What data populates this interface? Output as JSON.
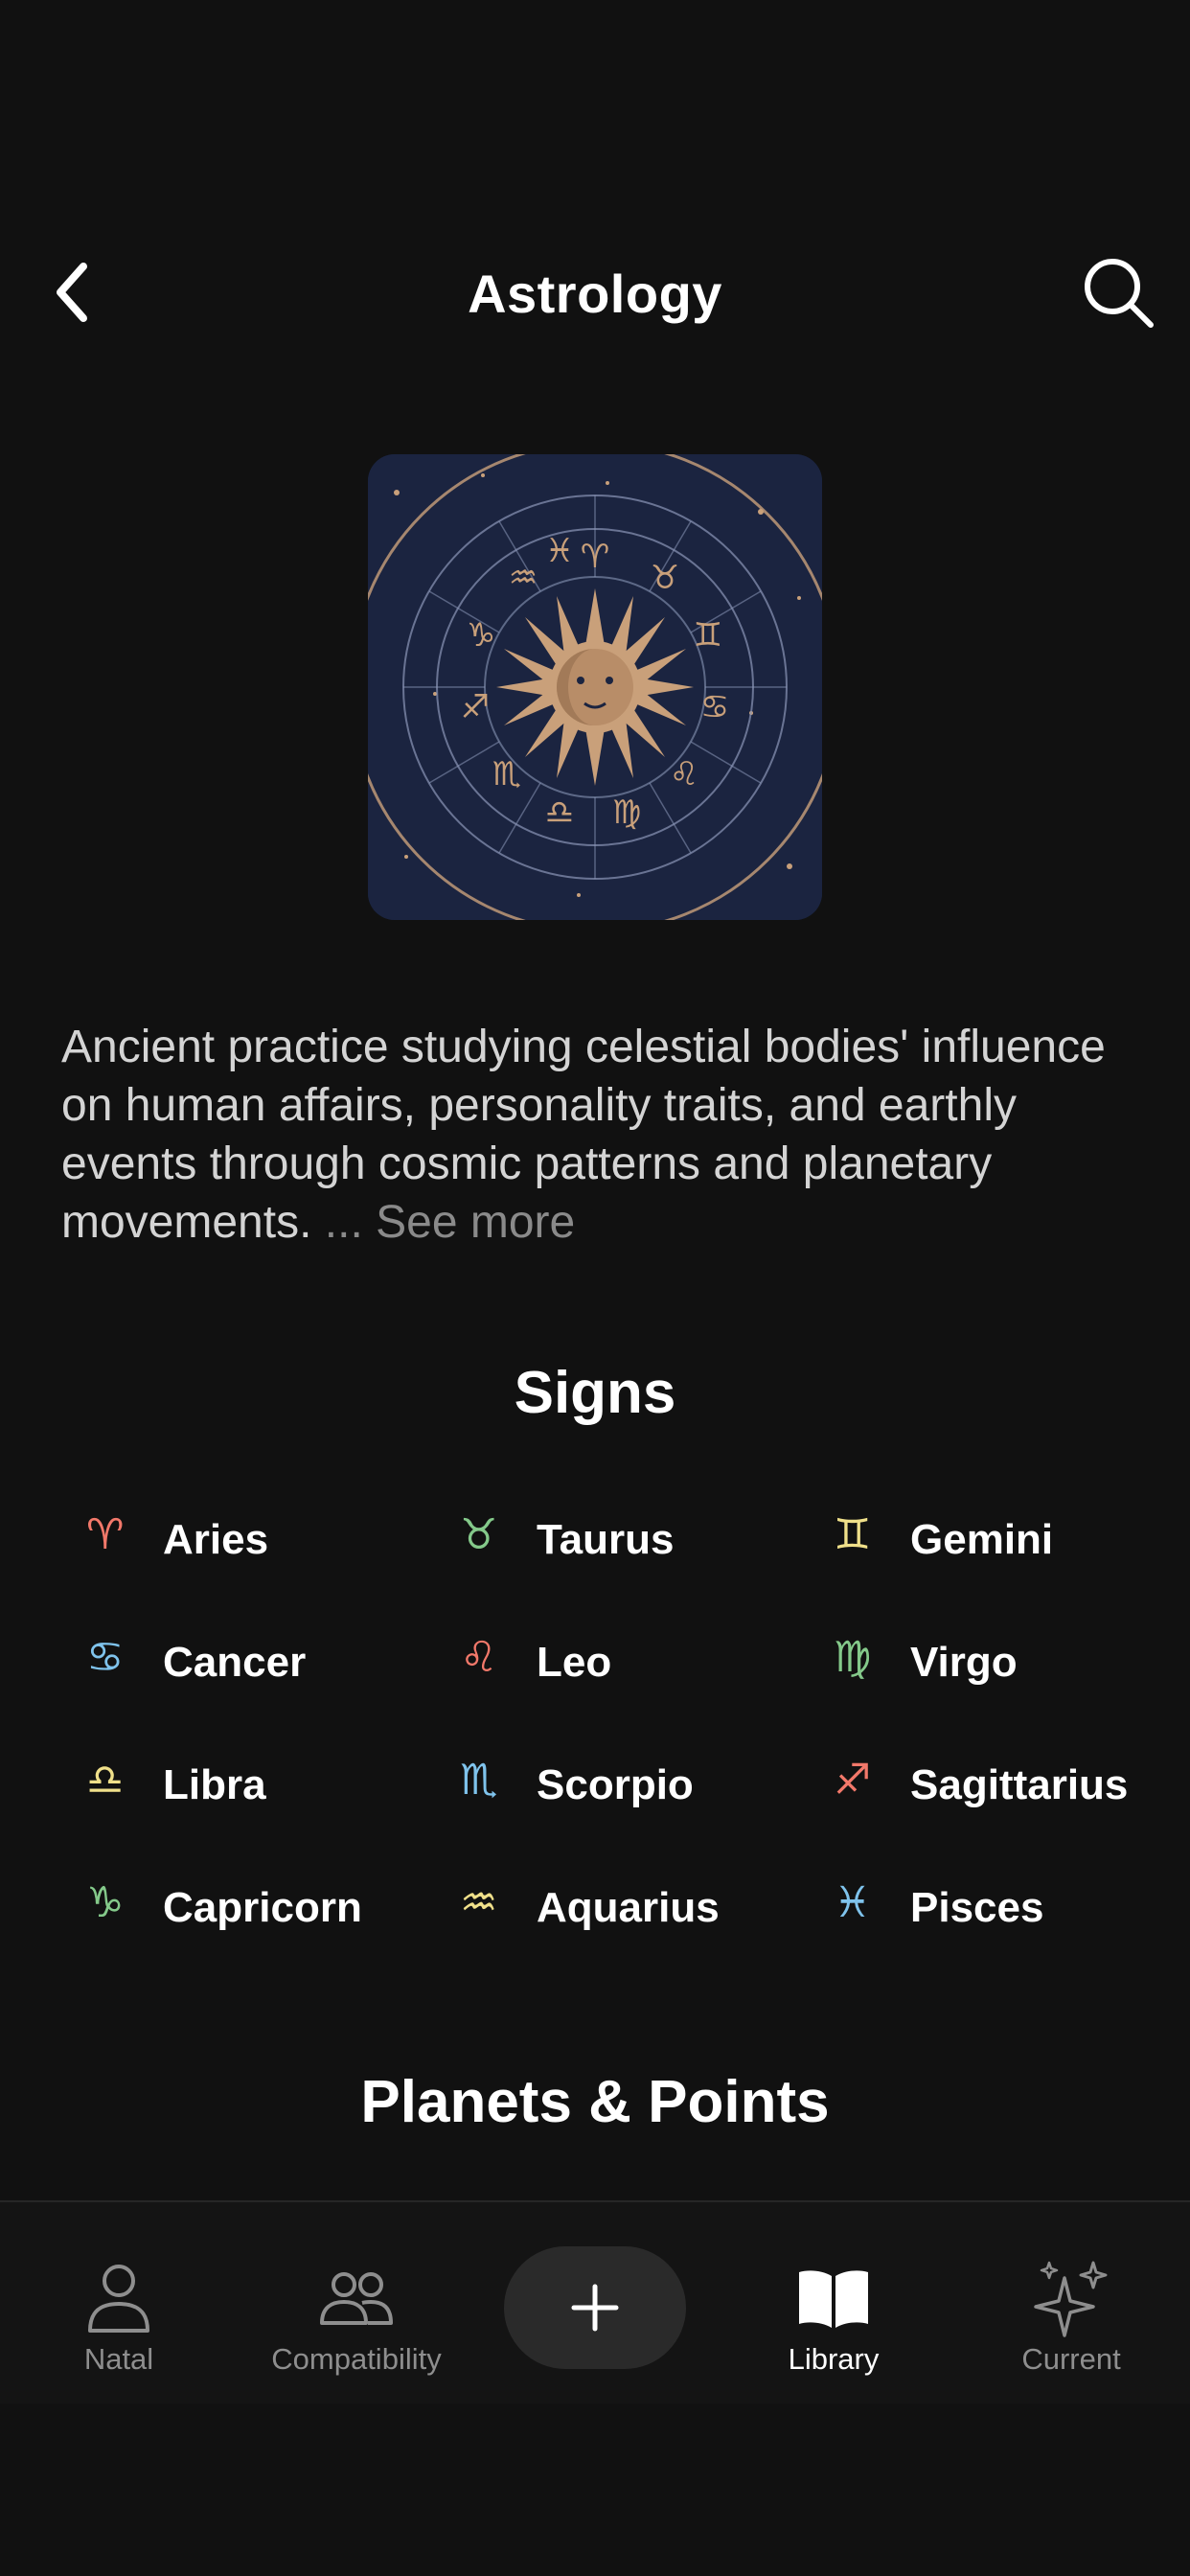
{
  "header": {
    "title": "Astrology"
  },
  "description": {
    "text": "Ancient practice studying celestial bodies' influence on human affairs, personality traits, and earthly events through cosmic patterns and planetary movements.",
    "ellipsis": "...",
    "see_more": "See more"
  },
  "signs": {
    "title": "Signs",
    "items": [
      {
        "name": "Aries",
        "glyph": "♈︎",
        "color": "#f2786a"
      },
      {
        "name": "Taurus",
        "glyph": "♉︎",
        "color": "#84c98a"
      },
      {
        "name": "Gemini",
        "glyph": "♊︎",
        "color": "#f0e08a"
      },
      {
        "name": "Cancer",
        "glyph": "♋︎",
        "color": "#7fc3ec"
      },
      {
        "name": "Leo",
        "glyph": "♌︎",
        "color": "#f2786a"
      },
      {
        "name": "Virgo",
        "glyph": "♍︎",
        "color": "#84c98a"
      },
      {
        "name": "Libra",
        "glyph": "♎︎",
        "color": "#f0e08a"
      },
      {
        "name": "Scorpio",
        "glyph": "♏︎",
        "color": "#7fc3ec"
      },
      {
        "name": "Sagittarius",
        "glyph": "♐︎",
        "color": "#f2786a"
      },
      {
        "name": "Capricorn",
        "glyph": "♑︎",
        "color": "#84c98a"
      },
      {
        "name": "Aquarius",
        "glyph": "♒︎",
        "color": "#f0e08a"
      },
      {
        "name": "Pisces",
        "glyph": "♓︎",
        "color": "#7fc3ec"
      }
    ]
  },
  "planets": {
    "title": "Planets & Points"
  },
  "tabbar": {
    "natal": "Natal",
    "compatibility": "Compatibility",
    "library": "Library",
    "current": "Current",
    "active": "Library"
  },
  "colors": {
    "background": "#111111",
    "hero_navy": "#1b2440",
    "hero_gold": "#c9a07a"
  },
  "icons": {
    "back": "chevron-left-icon",
    "search": "search-icon",
    "natal": "person-icon",
    "compatibility": "people-icon",
    "add": "plus-icon",
    "library": "book-icon",
    "current": "sparkles-icon"
  }
}
